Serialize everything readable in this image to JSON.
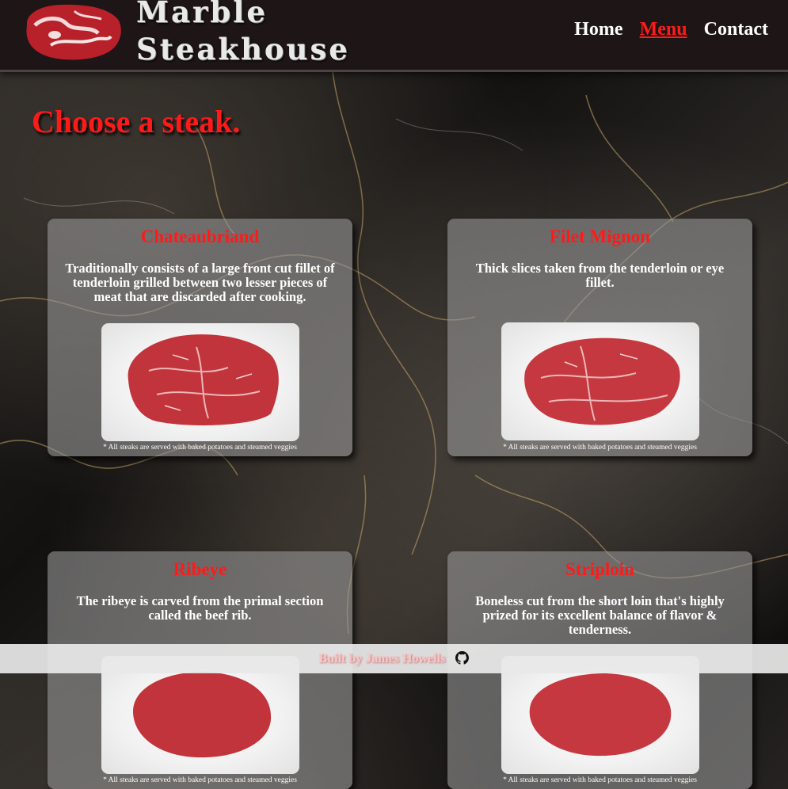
{
  "header": {
    "brand_line1": "Marble",
    "brand_line2": "Steakhouse",
    "nav": [
      {
        "label": "Home"
      },
      {
        "label": "Menu",
        "active": true
      },
      {
        "label": "Contact"
      }
    ]
  },
  "page": {
    "heading": "Choose a steak."
  },
  "steaks": [
    {
      "name": "Chateaubriand",
      "description": "Traditionally consists of a large front cut fillet of tenderloin grilled between two lesser pieces of meat that are discarded after cooking.",
      "note": "* All steaks are served with baked potatoes and steamed veggies"
    },
    {
      "name": "Filet Mignon",
      "description": "Thick slices taken from the tenderloin or eye fillet.",
      "note": "* All steaks are served with baked potatoes and steamed veggies"
    },
    {
      "name": "Ribeye",
      "description": "The ribeye is carved from the primal section called the beef rib.",
      "note": "* All steaks are served with baked potatoes and steamed veggies"
    },
    {
      "name": "Striploin",
      "description": "Boneless cut from the short loin that's highly prized for its excellent balance of flavor & tenderness.",
      "note": "* All steaks are served with baked potatoes and steamed veggies"
    }
  ],
  "footer": {
    "credit": "Built by James Howells",
    "icon": "github-icon"
  },
  "colors": {
    "accent": "#ff1a1a",
    "header_bg": "#1e1516"
  }
}
